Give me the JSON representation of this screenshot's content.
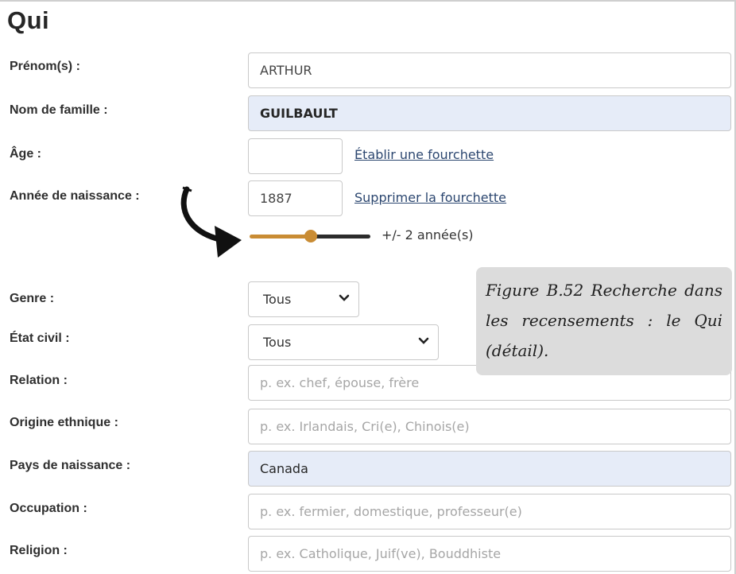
{
  "section_title": "Qui",
  "fields": {
    "prenom": {
      "label": "Prénom(s) :",
      "value": "ARTHUR"
    },
    "nom": {
      "label": "Nom de famille :",
      "value": "GUILBAULT"
    },
    "age": {
      "label": "Âge :",
      "value": "",
      "link": "Établir une fourchette"
    },
    "annee": {
      "label": "Année de naissance :",
      "value": "1887",
      "link": "Supprimer la fourchette"
    },
    "range": {
      "value_text": "+/- 2 année(s)",
      "level_fraction": 0.5
    },
    "genre": {
      "label": "Genre :",
      "selected": "Tous"
    },
    "etat_civil": {
      "label": "État civil :",
      "selected": "Tous"
    },
    "relation": {
      "label": "Relation :",
      "placeholder": "p. ex. chef, épouse, frère"
    },
    "origine": {
      "label": "Origine ethnique :",
      "placeholder": "p. ex. Irlandais, Cri(e), Chinois(e)"
    },
    "pays": {
      "label": "Pays de naissance :",
      "value": "Canada"
    },
    "occupation": {
      "label": "Occupation :",
      "placeholder": "p. ex. fermier, domestique, professeur(e)"
    },
    "religion": {
      "label": "Religion :",
      "placeholder": "p. ex. Catholique, Juif(ve), Bouddhiste"
    }
  },
  "caption": "Figure B.52 Recherche dans les recensements : le Qui (détail).",
  "colors": {
    "filled_input_bg": "#e6ecf8",
    "slider_accent": "#c98c34",
    "link": "#2c4770",
    "caption_bg": "#dcdcdc"
  }
}
